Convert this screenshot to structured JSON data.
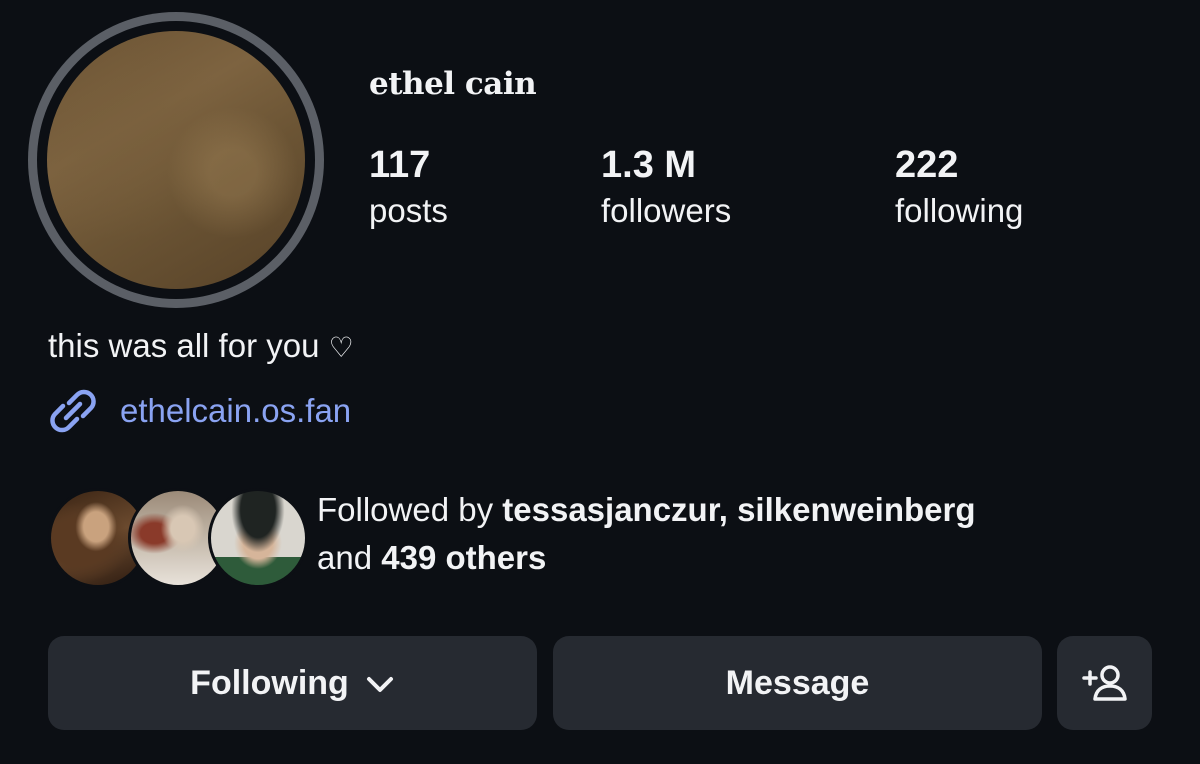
{
  "profile": {
    "username": "ethel cain",
    "avatar_icon": "profile-photo-icon"
  },
  "stats": {
    "posts": {
      "value": "117",
      "label": "posts"
    },
    "followers": {
      "value": "1.3 M",
      "label": "followers"
    },
    "following": {
      "value": "222",
      "label": "following"
    }
  },
  "bio": {
    "text": "this was all for you",
    "heart": "♡"
  },
  "link": {
    "icon": "link-icon",
    "text": "ethelcain.os.fan",
    "color": "#8aa3f2"
  },
  "followed_by": {
    "prefix": "Followed by",
    "user1": "tessasjanczur,",
    "user2": "silkenweinberg",
    "and": "and",
    "others": "439 others"
  },
  "actions": {
    "following_label": "Following",
    "following_icon": "chevron-down-icon",
    "message_label": "Message",
    "add_user_icon": "add-user-icon"
  },
  "colors": {
    "background": "#0c0f14",
    "button": "#262a31",
    "text": "#f2f3f5"
  }
}
